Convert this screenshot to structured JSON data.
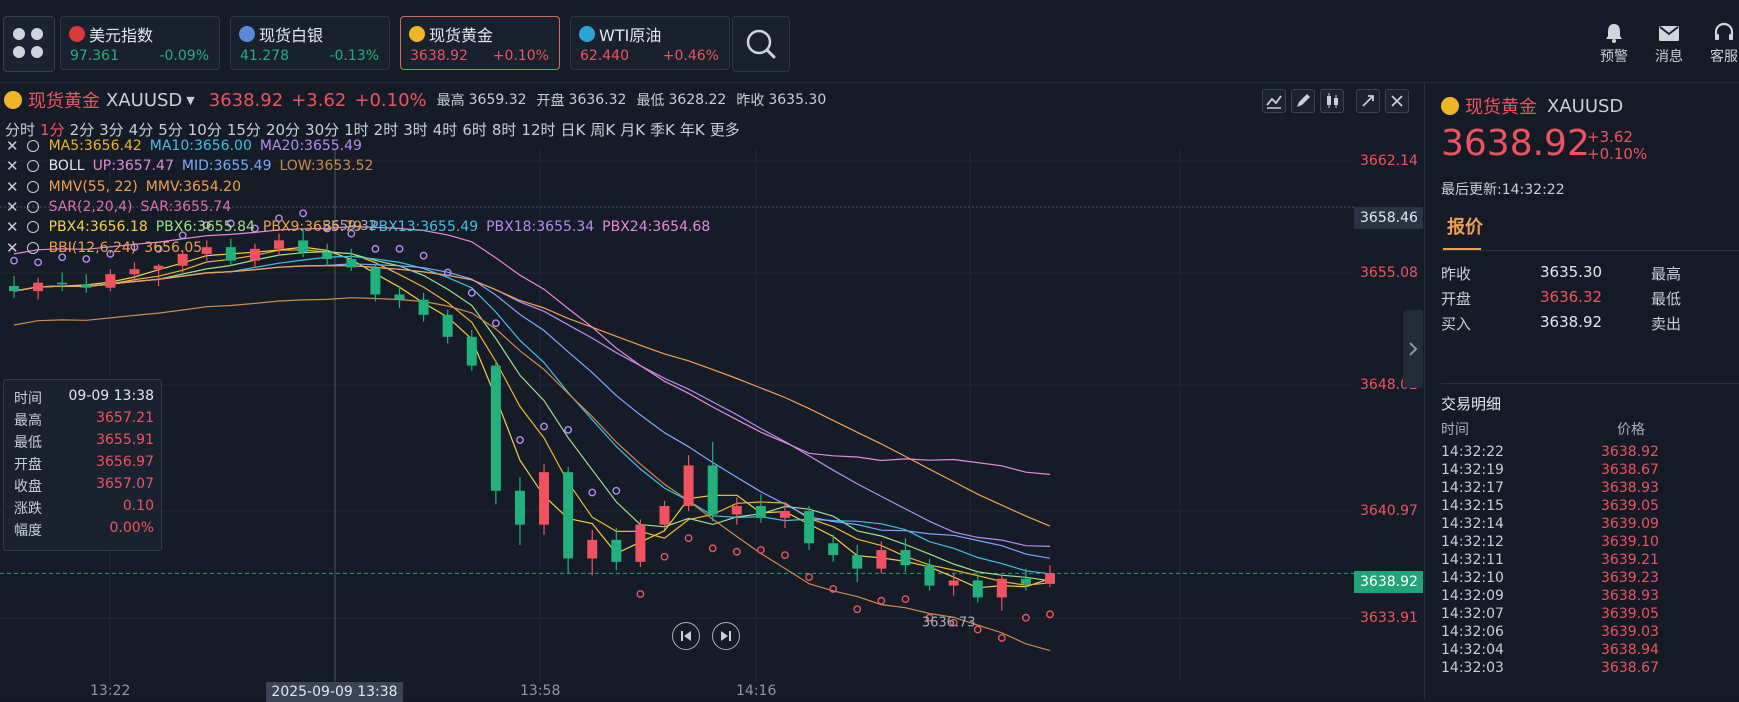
{
  "top_quotes": [
    {
      "name": "美元指数",
      "price": "97.361",
      "change": "-0.09%",
      "color": "#22b07d",
      "dot": "#d83b3b"
    },
    {
      "name": "现货白银",
      "price": "41.278",
      "change": "-0.13%",
      "color": "#22b07d",
      "dot": "#5b8bd8"
    },
    {
      "name": "现货黄金",
      "price": "3638.92",
      "change": "+0.10%",
      "color": "#f0525f",
      "dot": "#f0b429"
    },
    {
      "name": "WTI原油",
      "price": "62.440",
      "change": "+0.46%",
      "color": "#f0525f",
      "dot": "#2aa6d6"
    }
  ],
  "top_actions": {
    "alert": "预警",
    "message": "消息",
    "service": "客服"
  },
  "header": {
    "name": "现货黄金",
    "symbol": "XAUUSD",
    "price": "3638.92",
    "change": "+3.62",
    "change_pct": "+0.10%",
    "high_label": "最高",
    "high": "3659.32",
    "open_label": "开盘",
    "open": "3636.32",
    "low_label": "最低",
    "low": "3628.22",
    "prev_label": "昨收",
    "prev": "3635.30"
  },
  "periods": [
    "分时",
    "1分",
    "2分",
    "3分",
    "4分",
    "5分",
    "10分",
    "15分",
    "20分",
    "30分",
    "1时",
    "2时",
    "3时",
    "4时",
    "6时",
    "8时",
    "12时",
    "日K",
    "周K",
    "月K",
    "季K",
    "年K",
    "更多"
  ],
  "selected_period": "1分",
  "indicators": [
    {
      "parts": [
        {
          "t": "MA5:3656.42",
          "c": "#f0b429"
        },
        {
          "t": "MA10:3656.00",
          "c": "#3fc0e0"
        },
        {
          "t": "MA20:3655.49",
          "c": "#b68cf0"
        }
      ]
    },
    {
      "parts": [
        {
          "t": "BOLL",
          "c": "#e4e7ec"
        },
        {
          "t": "UP:3657.47",
          "c": "#e889d8"
        },
        {
          "t": "MID:3655.49",
          "c": "#7fa5ff"
        },
        {
          "t": "LOW:3653.52",
          "c": "#d08a4a"
        }
      ]
    },
    {
      "parts": [
        {
          "t": "MMV(55, 22)",
          "c": "#f0a04b"
        },
        {
          "t": "MMV:3654.20",
          "c": "#f0a04b"
        }
      ]
    },
    {
      "parts": [
        {
          "t": "SAR(2,20,4)",
          "c": "#e06fb0"
        },
        {
          "t": "SAR:3655.74",
          "c": "#e06fb0"
        }
      ]
    },
    {
      "parts": [
        {
          "t": "PBX4:3656.18",
          "c": "#f5d142"
        },
        {
          "t": "PBX6:3655.84",
          "c": "#9fe08a"
        },
        {
          "t": "PBX9:3655.79",
          "c": "#f0a04b"
        },
        {
          "t": "PBX13:3655.49",
          "c": "#3fc0e0"
        },
        {
          "t": "PBX18:3655.34",
          "c": "#b68cf0"
        },
        {
          "t": "PBX24:3654.68",
          "c": "#e889d8"
        }
      ]
    },
    {
      "parts": [
        {
          "t": "BBI(12,6,24)",
          "c": "#f0a04b"
        },
        {
          "t": "3656.05",
          "c": "#f0a04b"
        }
      ]
    }
  ],
  "tooltip": {
    "time_label": "时间",
    "time": "09-09 13:38",
    "high_label": "最高",
    "high": "3657.21",
    "low_label": "最低",
    "low": "3655.91",
    "open_label": "开盘",
    "open": "3656.97",
    "close_label": "收盘",
    "close": "3657.07",
    "chg_label": "涨跌",
    "chg": "0.10",
    "amp_label": "幅度",
    "amp": "0.00%"
  },
  "price_axis": [
    "3662.14",
    "3655.08",
    "3648.02",
    "3640.97",
    "3633.91"
  ],
  "crosshair_price": "3658.46",
  "current_price_tag": "3638.92",
  "time_axis": [
    "13:22",
    "13:58",
    "14:16"
  ],
  "crosshair_date": "2025-09-09 13:38",
  "annotations": {
    "high_mark": "3659.32",
    "low_mark": "3636.73"
  },
  "chart_data": {
    "type": "candlestick",
    "title": "",
    "ylim": [
      3632.5,
      3664
    ],
    "colors": {
      "up": "#f0525f",
      "down": "#22b07d"
    },
    "candles": [
      [
        3655.9,
        3656.5,
        3655.2,
        3655.6
      ],
      [
        3655.6,
        3656.4,
        3655.1,
        3656.1
      ],
      [
        3656.1,
        3656.7,
        3655.6,
        3656.0
      ],
      [
        3656.0,
        3656.6,
        3655.5,
        3655.8
      ],
      [
        3655.8,
        3656.9,
        3655.6,
        3656.6
      ],
      [
        3656.6,
        3657.3,
        3656.2,
        3656.9
      ],
      [
        3656.9,
        3657.2,
        3655.9,
        3657.1
      ],
      [
        3657.1,
        3658.0,
        3656.7,
        3657.8
      ],
      [
        3657.8,
        3658.6,
        3657.4,
        3658.2
      ],
      [
        3658.2,
        3658.7,
        3657.1,
        3657.4
      ],
      [
        3657.4,
        3658.4,
        3657.0,
        3658.1
      ],
      [
        3658.1,
        3659.0,
        3657.7,
        3658.6
      ],
      [
        3658.6,
        3659.3,
        3657.6,
        3657.9
      ],
      [
        3657.9,
        3658.4,
        3657.1,
        3657.5
      ],
      [
        3657.5,
        3658.1,
        3656.8,
        3657.0
      ],
      [
        3657.0,
        3657.2,
        3655.0,
        3655.4
      ],
      [
        3655.4,
        3655.9,
        3654.6,
        3655.1
      ],
      [
        3655.1,
        3655.5,
        3653.8,
        3654.2
      ],
      [
        3654.2,
        3654.5,
        3652.5,
        3652.9
      ],
      [
        3652.9,
        3653.3,
        3650.9,
        3651.2
      ],
      [
        3651.2,
        3651.5,
        3643.0,
        3643.8
      ],
      [
        3643.8,
        3644.6,
        3640.6,
        3641.8
      ],
      [
        3641.8,
        3645.4,
        3641.2,
        3644.9
      ],
      [
        3644.9,
        3645.2,
        3638.9,
        3639.8
      ],
      [
        3639.8,
        3641.5,
        3638.8,
        3640.9
      ],
      [
        3640.9,
        3641.6,
        3639.1,
        3639.6
      ],
      [
        3639.6,
        3642.1,
        3639.3,
        3641.8
      ],
      [
        3641.8,
        3643.2,
        3641.5,
        3642.9
      ],
      [
        3642.9,
        3645.9,
        3642.6,
        3645.3
      ],
      [
        3645.3,
        3646.7,
        3642.0,
        3642.4
      ],
      [
        3642.4,
        3643.4,
        3641.8,
        3642.9
      ],
      [
        3642.9,
        3643.6,
        3641.9,
        3642.2
      ],
      [
        3642.2,
        3643.1,
        3641.6,
        3642.6
      ],
      [
        3642.6,
        3642.9,
        3640.3,
        3640.7
      ],
      [
        3640.7,
        3641.2,
        3639.6,
        3640.0
      ],
      [
        3640.0,
        3640.6,
        3638.4,
        3639.2
      ],
      [
        3639.2,
        3640.8,
        3638.9,
        3640.3
      ],
      [
        3640.3,
        3641.0,
        3639.0,
        3639.4
      ],
      [
        3639.4,
        3639.8,
        3637.9,
        3638.2
      ],
      [
        3638.2,
        3638.9,
        3637.6,
        3638.5
      ],
      [
        3638.5,
        3638.9,
        3637.2,
        3637.5
      ],
      [
        3637.5,
        3638.8,
        3636.7,
        3638.6
      ],
      [
        3638.6,
        3639.2,
        3637.9,
        3638.3
      ],
      [
        3638.3,
        3639.4,
        3638.1,
        3638.92
      ]
    ]
  },
  "right_panel": {
    "name": "现货黄金",
    "symbol": "XAUUSD",
    "price": "3638.92",
    "change": "+3.62",
    "change_pct": "+0.10%",
    "update_label": "最后更新:",
    "update_time": "14:32:22",
    "tab": "报价",
    "quotes": [
      {
        "label": "昨收",
        "value": "3635.30",
        "color": "#e4e7ec",
        "label2": "最高"
      },
      {
        "label": "开盘",
        "value": "3636.32",
        "color": "#f0525f",
        "label2": "最低"
      },
      {
        "label": "买入",
        "value": "3638.92",
        "color": "#e4e7ec",
        "label2": "卖出"
      }
    ],
    "trades_title": "交易明细",
    "col_time": "时间",
    "col_price": "价格",
    "trades": [
      {
        "time": "14:32:22",
        "price": "3638.92"
      },
      {
        "time": "14:32:19",
        "price": "3638.67"
      },
      {
        "time": "14:32:17",
        "price": "3638.93"
      },
      {
        "time": "14:32:15",
        "price": "3639.05"
      },
      {
        "time": "14:32:14",
        "price": "3639.09"
      },
      {
        "time": "14:32:12",
        "price": "3639.10"
      },
      {
        "time": "14:32:11",
        "price": "3639.21"
      },
      {
        "time": "14:32:10",
        "price": "3639.23"
      },
      {
        "time": "14:32:09",
        "price": "3638.93"
      },
      {
        "time": "14:32:07",
        "price": "3639.05"
      },
      {
        "time": "14:32:06",
        "price": "3639.03"
      },
      {
        "time": "14:32:04",
        "price": "3638.94"
      },
      {
        "time": "14:32:03",
        "price": "3638.67"
      }
    ]
  }
}
